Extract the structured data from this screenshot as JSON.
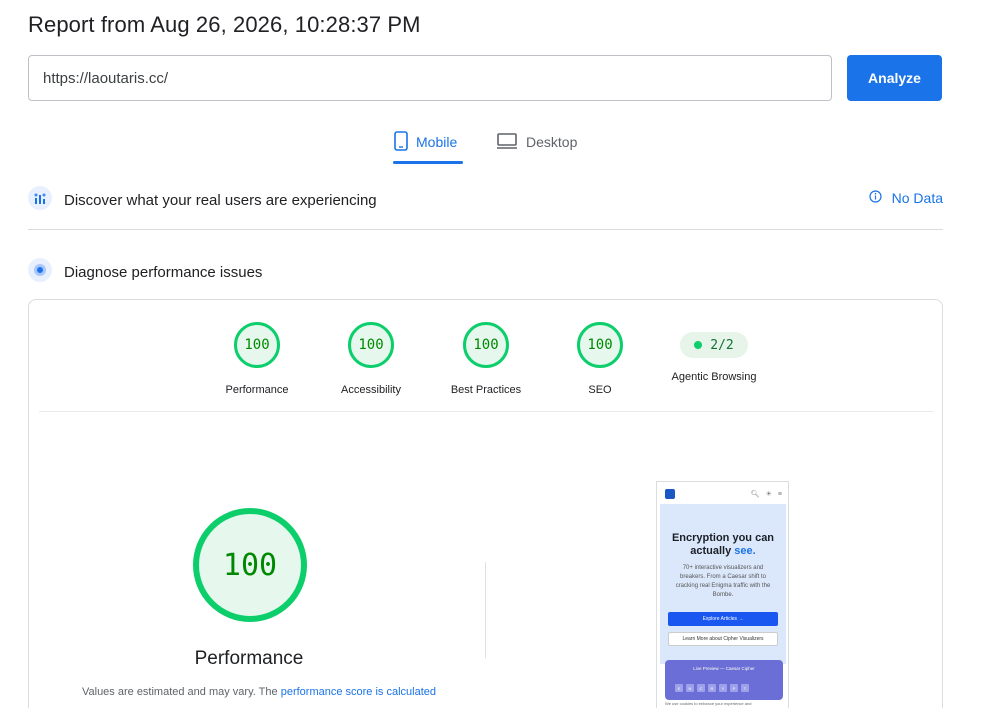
{
  "report": {
    "title": "Report from Aug 26, 2026, 10:28:37 PM"
  },
  "search": {
    "url": "https://laoutaris.cc/",
    "analyze_label": "Analyze"
  },
  "tabs": [
    {
      "label": "Mobile",
      "icon": "mobile-phone-icon",
      "active": true
    },
    {
      "label": "Desktop",
      "icon": "desktop-monitor-icon",
      "active": false
    }
  ],
  "crux": {
    "label": "Discover what your real users are experiencing",
    "status": "No Data"
  },
  "diagnose": {
    "label": "Diagnose performance issues"
  },
  "scores": [
    {
      "label": "Performance",
      "value": "100"
    },
    {
      "label": "Accessibility",
      "value": "100"
    },
    {
      "label": "Best Practices",
      "value": "100"
    },
    {
      "label": "SEO",
      "value": "100"
    }
  ],
  "agentic": {
    "label": "Agentic Browsing",
    "value": "2/2"
  },
  "main_score": {
    "value": "100",
    "label": "Performance",
    "note_prefix": "Values are estimated and may vary. The ",
    "note_link": "performance score is calculated"
  },
  "preview": {
    "headline_1": "Encryption you can",
    "headline_2": "actually ",
    "headline_accent": "see.",
    "subtext": "70+ interactive visualizers and breakers. From a Caesar shift to cracking real Enigma traffic with the Bombe.",
    "primary_button": "Explore Articles →",
    "secondary_button": "Learn More about Cipher Visualizers",
    "panel_title": "Live Preview — Caesar Cipher",
    "keys": [
      "E",
      "N",
      "C",
      "R",
      "Y",
      "P",
      "T"
    ],
    "footer": "We use cookies to enhance your experience and"
  },
  "colors": {
    "accent": "#1a73e8",
    "pass": "#0cce6b",
    "pass_text": "#008800"
  }
}
